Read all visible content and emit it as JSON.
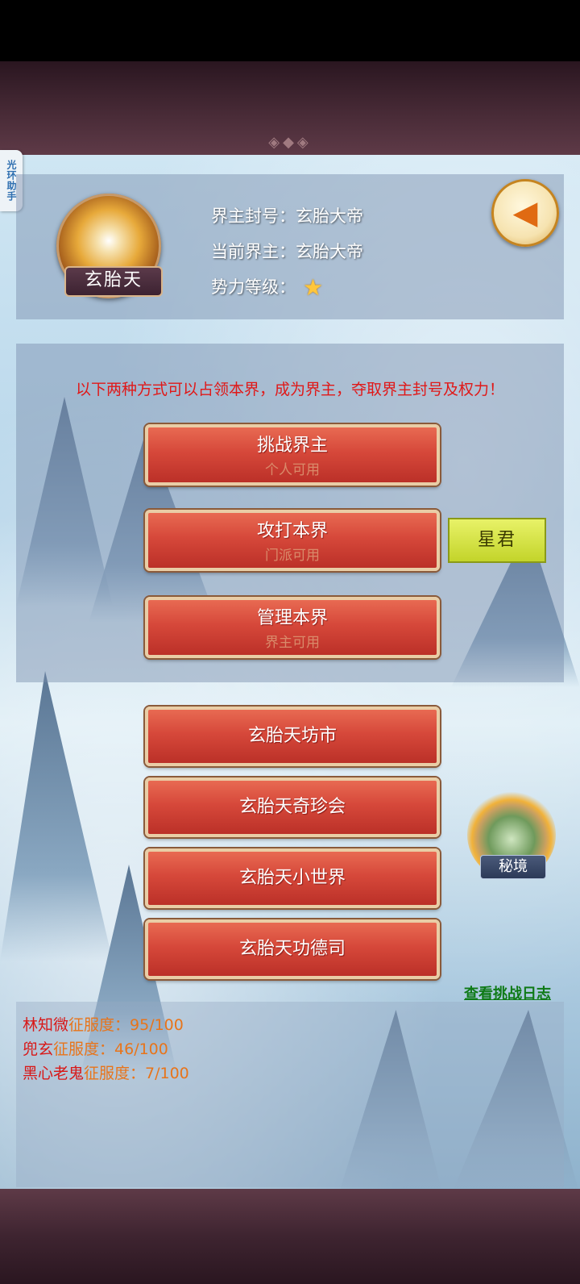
{
  "side_tab": {
    "label": "光环助手"
  },
  "header": {
    "emblem_name": "玄胎天",
    "title_line": "界主封号：玄胎大帝",
    "lord_line": "当前界主：玄胎大帝",
    "level_label": "势力等级：",
    "level_stars": 1,
    "star_icon": "star-icon",
    "back_icon": "back-arrow-icon"
  },
  "actions": {
    "notice": "以下两种方式可以占领本界，成为界主，夺取界主封号及权力！",
    "challenge": {
      "label": "挑战界主",
      "sub": "个人可用"
    },
    "attack": {
      "label": "攻打本界",
      "sub": "门派可用"
    },
    "manage": {
      "label": "管理本界",
      "sub": "界主可用"
    },
    "star_lord": "星君"
  },
  "menu": {
    "market": "玄胎天坊市",
    "treasure": "玄胎天奇珍会",
    "small_world": "玄胎天小世界",
    "merit": "玄胎天功德司"
  },
  "secret_realm": {
    "label": "秘境"
  },
  "log": {
    "link": "查看挑战日志",
    "entries": [
      {
        "name": "林知微",
        "text": "征服度：95/100"
      },
      {
        "name": "兜玄",
        "text": "征服度：46/100"
      },
      {
        "name": "黑心老鬼",
        "text": "征服度：7/100"
      }
    ]
  },
  "colors": {
    "notice_red": "#e01818",
    "button_red": "#d6483a",
    "star_lord_green": "#c3d42a",
    "link_green": "#0e7a16",
    "conquest_orange": "#e8741a"
  }
}
